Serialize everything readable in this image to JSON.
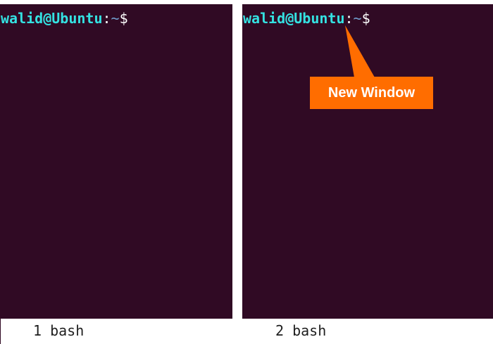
{
  "panes": [
    {
      "prompt": {
        "user_host": "walid@Ubuntu",
        "colon": ":",
        "path": "~",
        "symbol": "$"
      }
    },
    {
      "prompt": {
        "user_host": "walid@Ubuntu",
        "colon": ":",
        "path": "~",
        "symbol": "$"
      }
    }
  ],
  "callout": {
    "text": "New Window",
    "color": "#ff6d00"
  },
  "statusbar": {
    "windows": [
      {
        "label": "1 bash"
      },
      {
        "label": "2 bash"
      }
    ]
  },
  "colors": {
    "terminal_background": "#300a24",
    "user_host": "#34e2e2",
    "path": "#729fcf"
  }
}
